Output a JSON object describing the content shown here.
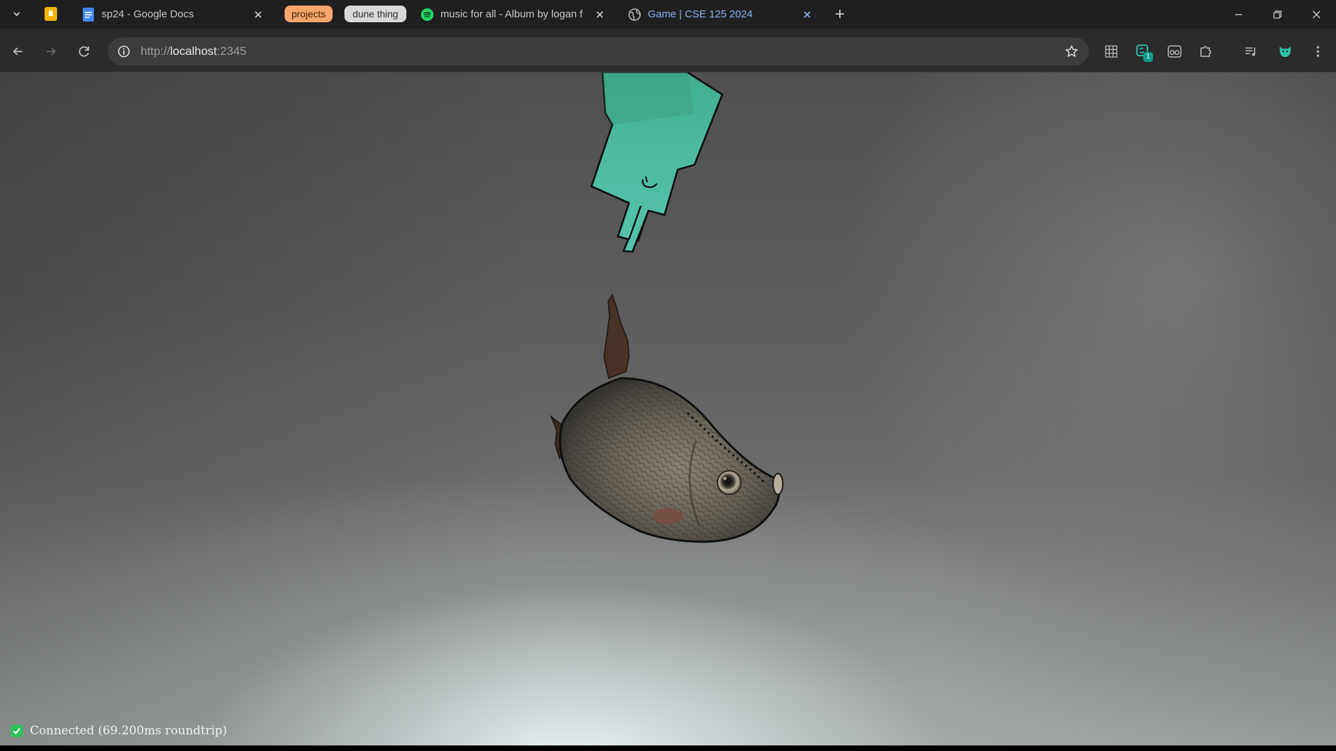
{
  "tabs": {
    "items": [
      {
        "title": "sp24 - Google Docs",
        "icon": "google-docs-icon"
      },
      {
        "title": "music for all - Album by logan f",
        "icon": "spotify-icon"
      },
      {
        "title": "Game | CSE 125 2024",
        "icon": "globe-icon"
      }
    ],
    "groups": [
      {
        "label": "projects",
        "color": "#f7a76c",
        "text_color": "#3a1f0a"
      },
      {
        "label": "dune thing",
        "color": "#d9d9d9",
        "text_color": "#2b2b2b"
      }
    ]
  },
  "omnibox": {
    "scheme": "http://",
    "host": "localhost",
    "port": ":2345"
  },
  "toolbar": {
    "extension_badge": "1"
  },
  "game": {
    "status_text": "Connected (69.200ms roundtrip)"
  },
  "colors": {
    "tabstrip": "#1f1f1f",
    "toolbar": "#2b2b2b",
    "omnibox": "#3c3c3c",
    "accent": "#8ab4f8",
    "connected": "#2fbf5a",
    "character": "#49b19a"
  }
}
